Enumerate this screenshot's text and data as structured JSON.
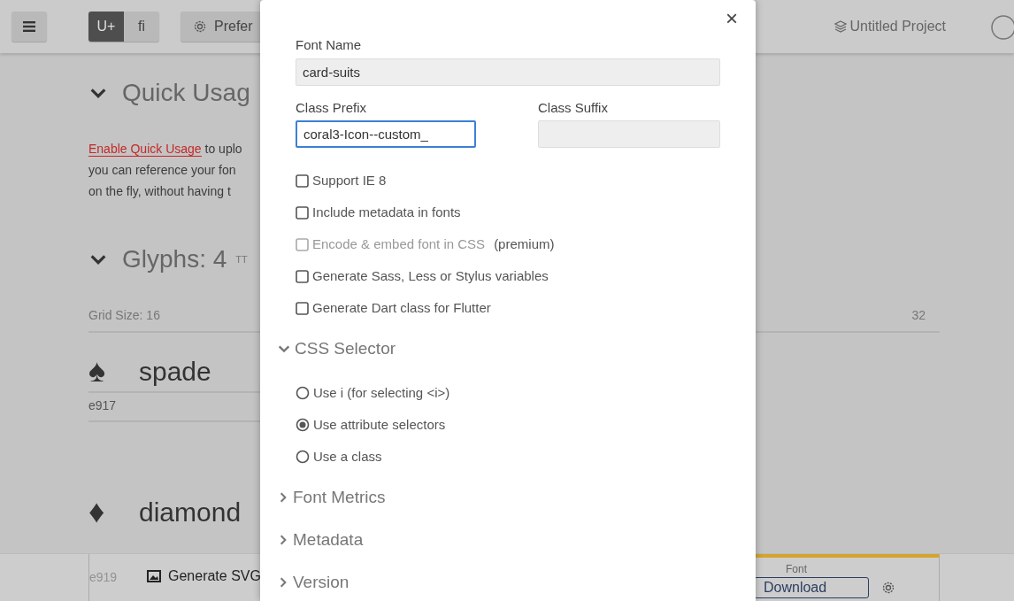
{
  "toolbar": {
    "view_toggle": [
      {
        "label": "U+",
        "selected": true
      },
      {
        "label": "ﬁ",
        "selected": false
      }
    ],
    "preferences_button": "Prefer",
    "project": "Untitled Project"
  },
  "quick_usage": {
    "title": "Quick Usag",
    "expanded": true,
    "link": "Enable Quick Usage",
    "lines": [
      "to uplo",
      "you can reference your fon",
      "on the fly, without having t"
    ]
  },
  "glyphs": {
    "title": "Glyphs: 4",
    "tag": "TT",
    "expanded": true,
    "grid_label": "Grid Size: 16",
    "grid_max": "32",
    "items": [
      {
        "glyph": "♠",
        "name": "spade",
        "code": "e917"
      },
      {
        "glyph": "♦",
        "name": "diamond",
        "code": "e919"
      }
    ]
  },
  "bottom_bar": {
    "generate_button": "Generate SVG",
    "font_label": "Font",
    "download_button": "Download"
  },
  "dialog": {
    "close": "×",
    "font_name": {
      "label": "Font Name",
      "value": "card-suits"
    },
    "class_prefix": {
      "label": "Class Prefix",
      "value": "coral3-Icon--custom_",
      "focused": true
    },
    "class_suffix": {
      "label": "Class Suffix"
    },
    "options": [
      {
        "label": "Support IE 8",
        "checked": false,
        "disabled": false
      },
      {
        "label": "Include metadata in fonts",
        "checked": false,
        "disabled": false
      },
      {
        "label": "Encode & embed font in CSS",
        "note": "(premium)",
        "checked": false,
        "disabled": true
      },
      {
        "label": "Generate Sass, Less or Stylus variables",
        "checked": false,
        "disabled": false
      },
      {
        "label": "Generate Dart class for Flutter",
        "checked": false,
        "disabled": false
      }
    ],
    "css_selector": {
      "title": "CSS Selector",
      "expanded": true,
      "choices": [
        {
          "label": "Use i (for selecting <i>)",
          "selected": false
        },
        {
          "label": "Use attribute selectors",
          "selected": true
        },
        {
          "label": "Use a class",
          "selected": false
        }
      ]
    },
    "sections": [
      {
        "title": "Font Metrics",
        "expanded": false
      },
      {
        "title": "Metadata",
        "expanded": false
      },
      {
        "title": "Version",
        "expanded": false
      }
    ]
  }
}
